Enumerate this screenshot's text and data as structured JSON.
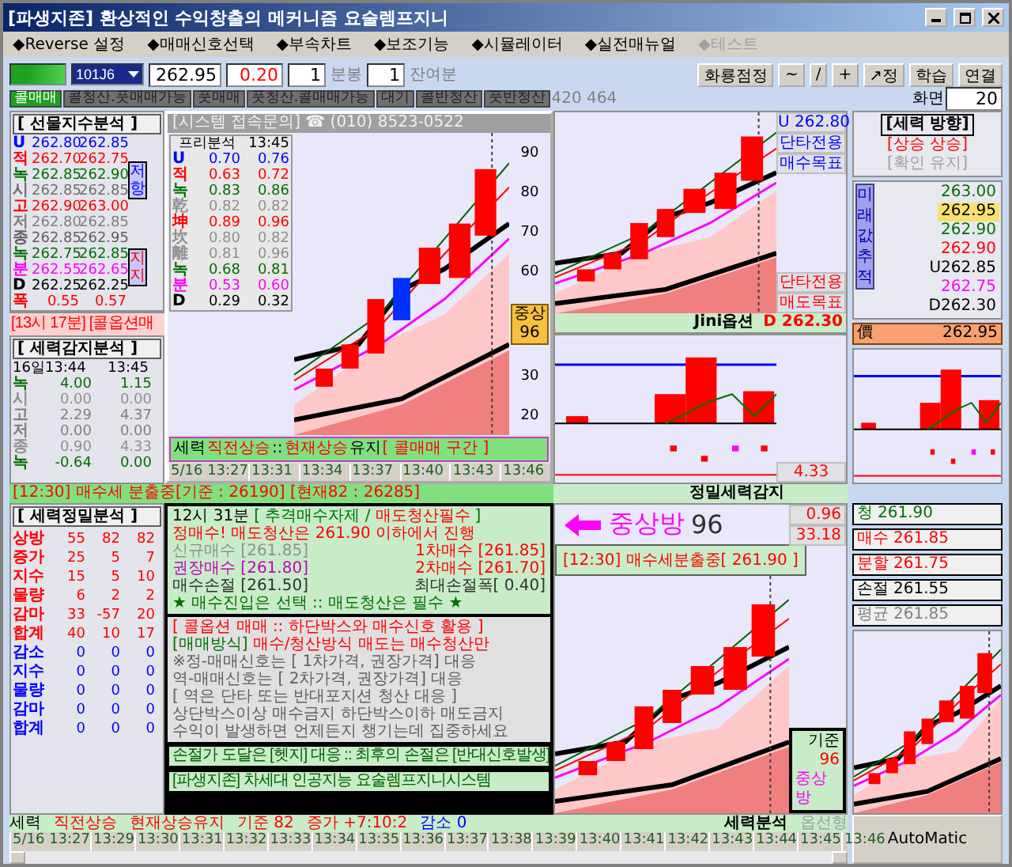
{
  "window": {
    "title": "[파생지존] 환상적인 수익창출의 메커니즘 요술렘프지니"
  },
  "menu": [
    {
      "label": "◆Reverse 설정",
      "disabled": false
    },
    {
      "label": "◆매매신호선택",
      "disabled": false
    },
    {
      "label": "◆부속차트",
      "disabled": false
    },
    {
      "label": "◆보조기능",
      "disabled": false
    },
    {
      "label": "◆시뮬레이터",
      "disabled": false
    },
    {
      "label": "◆실전매뉴얼",
      "disabled": false
    },
    {
      "label": "◆테스트",
      "disabled": true
    }
  ],
  "toolbar": {
    "code": "101J6",
    "price": "262.95",
    "change": "0.20",
    "interval": "1",
    "interval_label": "분봉",
    "remaining": "1",
    "remaining_label": "잔여분",
    "buttons": [
      "화룡점정",
      "~",
      "/",
      "+",
      "↗정",
      "학습",
      "연결"
    ]
  },
  "signals": [
    {
      "label": "콜매매",
      "selected": true
    },
    {
      "label": "콜청산.풋매매가능",
      "selected": false
    },
    {
      "label": "풋매매",
      "selected": false
    },
    {
      "label": "풋청산.콜매매가능",
      "selected": false
    },
    {
      "label": "대기",
      "selected": false
    },
    {
      "label": "콜반청산",
      "selected": false
    },
    {
      "label": "풋반청산",
      "selected": false
    }
  ],
  "signal_count": "420 464",
  "screen": {
    "label": "화면",
    "value": "20"
  },
  "futures_panel": {
    "title": "[ 선물지수분석 ]",
    "rows": [
      {
        "label": "U",
        "values": [
          "262.80",
          "262.85"
        ],
        "color": "#0000ff"
      },
      {
        "label": "적",
        "values": [
          "262.70",
          "262.75"
        ],
        "color": "#ff0000"
      },
      {
        "label": "녹",
        "values": [
          "262.85",
          "262.90"
        ],
        "color": "#007000"
      },
      {
        "label": "시",
        "values": [
          "262.85",
          "262.85"
        ],
        "color": "#707070"
      },
      {
        "label": "고",
        "values": [
          "262.90",
          "263.00"
        ],
        "color": "#ff0000"
      },
      {
        "label": "저",
        "values": [
          "262.80",
          "262.85"
        ],
        "color": "#808080"
      },
      {
        "label": "종",
        "values": [
          "262.85",
          "262.95"
        ],
        "color": "#606060"
      },
      {
        "label": "녹",
        "values": [
          "262.75",
          "262.85"
        ],
        "color": "#007000"
      },
      {
        "label": "분",
        "values": [
          "262.55",
          "262.65"
        ],
        "color": "#ff00ff"
      },
      {
        "label": "D",
        "values": [
          "262.25",
          "262.25"
        ],
        "color": "#000000"
      },
      {
        "label": "폭",
        "values": [
          "0.55",
          "0.57"
        ],
        "color": "#ff0000"
      }
    ],
    "side_labels": [
      {
        "text": "저항",
        "color": "#0000ff"
      },
      {
        "text": "지지",
        "color": "#ff0000"
      }
    ]
  },
  "alert_band": "[13시 17분] [콜옵션매",
  "power_panel": {
    "title": "[ 세력감지분석 ]",
    "date": "16일13:44",
    "time": "13:45",
    "rows": [
      {
        "label": "녹",
        "values": [
          "4.00",
          "1.15"
        ],
        "color": "#007000"
      },
      {
        "label": "시",
        "values": [
          "0.00",
          "0.00"
        ],
        "color": "#909090"
      },
      {
        "label": "고",
        "values": [
          "2.29",
          "4.37"
        ],
        "color": "#808080"
      },
      {
        "label": "저",
        "values": [
          "0.00",
          "0.00"
        ],
        "color": "#808080"
      },
      {
        "label": "종",
        "values": [
          "0.90",
          "4.33"
        ],
        "color": "#909090"
      },
      {
        "label": "녹",
        "values": [
          "-0.64",
          "0.00"
        ],
        "color": "#007000"
      }
    ]
  },
  "popup": {
    "title": "[시스템 접속문의] ☎ (010) 8523-0522",
    "table_title": "프리분석",
    "table_time": "13:45",
    "rows": [
      {
        "label": "U",
        "values": [
          "0.70",
          "0.76"
        ],
        "color": "#0000ff"
      },
      {
        "label": "적",
        "values": [
          "0.63",
          "0.72"
        ],
        "color": "#ff0000"
      },
      {
        "label": "녹",
        "values": [
          "0.83",
          "0.86"
        ],
        "color": "#007000"
      },
      {
        "label": "乾",
        "values": [
          "0.82",
          "0.82"
        ],
        "color": "#909090"
      },
      {
        "label": "坤",
        "values": [
          "0.89",
          "0.96"
        ],
        "color": "#ff0000"
      },
      {
        "label": "坎",
        "values": [
          "0.80",
          "0.82"
        ],
        "color": "#909090"
      },
      {
        "label": "離",
        "values": [
          "0.81",
          "0.96"
        ],
        "color": "#909090"
      },
      {
        "label": "녹",
        "values": [
          "0.68",
          "0.81"
        ],
        "color": "#007000"
      },
      {
        "label": "분",
        "values": [
          "0.53",
          "0.60"
        ],
        "color": "#ff00ff"
      },
      {
        "label": "D",
        "values": [
          "0.29",
          "0.32"
        ],
        "color": "#000000"
      }
    ],
    "y_labels": [
      "90",
      "80",
      "70",
      "60",
      "30",
      "20"
    ],
    "badge": {
      "label": "중상",
      "value": "96"
    },
    "banner": [
      {
        "text": "세력",
        "kind": "plain"
      },
      {
        "text": "직전상승",
        "kind": "emphasis"
      },
      {
        "text": "::",
        "kind": "plain"
      },
      {
        "text": "현재상승",
        "kind": "emphasis"
      },
      {
        "text": "유지",
        "kind": "plain"
      },
      {
        "text": "[ 콜매매 구간 ]",
        "kind": "emphasis"
      }
    ],
    "times": [
      "5/16 13:27",
      "13:31",
      "13:34",
      "13:37",
      "13:40",
      "13:43",
      "13:46"
    ]
  },
  "upper_chart": {
    "buy_price": "U 262.80",
    "buy_lines": [
      "단타전용",
      "매수목표"
    ],
    "sell_lines": [
      "단타전용",
      "매도목표"
    ],
    "name": "Jini옵션",
    "sell_price": "D 262.30"
  },
  "lower_chart": {
    "value": "4.33",
    "name": "정밀세력감지"
  },
  "direction": {
    "title": "[세력 방향]",
    "lines": [
      {
        "text": "[상승 상승]",
        "color": "#ff0000"
      },
      {
        "text": "[확인 유지]",
        "color": "#a0a0a0"
      }
    ],
    "vertical_label": "미래값추적",
    "prices": [
      {
        "text": "263.00",
        "color": "#007000",
        "selected": false
      },
      {
        "text": "262.95",
        "color": "#000000",
        "selected": true
      },
      {
        "text": "262.90",
        "color": "#007000",
        "selected": false
      },
      {
        "text": "262.90",
        "color": "#ff0000",
        "selected": false
      },
      {
        "text": "U262.85",
        "color": "#000000",
        "selected": false
      },
      {
        "text": "262.75",
        "color": "#ff00ff",
        "selected": false
      },
      {
        "text": "D262.30",
        "color": "#000000",
        "selected": false
      }
    ],
    "current_label": "價",
    "current": "262.95"
  },
  "strip": "[12:30] 매수세 분출중[기준 : 26190] [현재82 : 26285]",
  "precise_panel": {
    "title": "[ 세력정밀분석 ]",
    "rows": [
      {
        "label": "상방",
        "values": [
          "55",
          "82",
          "82"
        ],
        "color": "#ff0000"
      },
      {
        "label": "증가",
        "values": [
          "25",
          "5",
          "7"
        ],
        "color": "#ff0000"
      },
      {
        "label": "지수",
        "values": [
          "15",
          "5",
          "10"
        ],
        "color": "#ff0000"
      },
      {
        "label": "물량",
        "values": [
          "6",
          "2",
          "2"
        ],
        "color": "#ff0000"
      },
      {
        "label": "감마",
        "values": [
          "33",
          "-57",
          "20"
        ],
        "color": "#ff0000"
      },
      {
        "label": "합계",
        "values": [
          "40",
          "10",
          "17"
        ],
        "color": "#ff0000"
      },
      {
        "label": "감소",
        "values": [
          "0",
          "0",
          "0"
        ],
        "color": "#0000ff"
      },
      {
        "label": "지수",
        "values": [
          "0",
          "0",
          "0"
        ],
        "color": "#0000ff"
      },
      {
        "label": "물량",
        "values": [
          "0",
          "0",
          "0"
        ],
        "color": "#0000ff"
      },
      {
        "label": "감마",
        "values": [
          "0",
          "0",
          "0"
        ],
        "color": "#0000ff"
      },
      {
        "label": "합계",
        "values": [
          "0",
          "0",
          "0"
        ],
        "color": "#0000ff"
      }
    ]
  },
  "guide_box": {
    "lines": [
      {
        "kind": "text",
        "parts": [
          {
            "text": "12시 31분",
            "color": "#000000"
          },
          {
            "text": "[ 추격매수자제 /",
            "color": "#007000"
          },
          {
            "text": "매도청산필수",
            "color": "#ff0000"
          },
          {
            "text": "]",
            "color": "#007000"
          }
        ]
      },
      {
        "kind": "text",
        "parts": [
          {
            "text": "정매수! 매도청산은 261.90 이하에서 진행",
            "color": "#ff0000"
          }
        ]
      },
      {
        "kind": "pair",
        "parts": [
          {
            "text": "신규매수 [261.85]",
            "color": "#909090"
          },
          {
            "text": "1차매수 [261.85]",
            "color": "#ff0000"
          }
        ]
      },
      {
        "kind": "pair",
        "parts": [
          {
            "text": "권장매수 [261.80]",
            "color": "#c000c0"
          },
          {
            "text": "2차매수 [261.70]",
            "color": "#ff0000"
          }
        ]
      },
      {
        "kind": "pair",
        "parts": [
          {
            "text": "매수손절 [261.50]",
            "color": "#303030"
          },
          {
            "text": "최대손절폭[ 0.40]",
            "color": "#303030"
          }
        ]
      },
      {
        "kind": "text",
        "parts": [
          {
            "text": "★ 매수진입은 선택 :: 매도청산은 필수 ★",
            "color": "#007000"
          }
        ]
      }
    ]
  },
  "rule_box": {
    "lines": [
      {
        "parts": [
          {
            "text": "[ 콜옵션 매매 :: 하단박스와 매수신호 활용 ]",
            "color": "#ff0000"
          }
        ]
      },
      {
        "parts": [
          {
            "text": "[매매방식]",
            "color": "#007000"
          },
          {
            "text": "매수/청산방식 매도는 매수청산만",
            "color": "#ff0000"
          }
        ]
      },
      {
        "parts": [
          {
            "text": "※정-매매신호는 [ 1차가격, 권장가격] 대응",
            "color": "#606060"
          }
        ]
      },
      {
        "parts": [
          {
            "text": "역-매매신호는 [ 2차가격, 권장가격] 대응",
            "color": "#606060"
          }
        ]
      },
      {
        "parts": [
          {
            "text": "[ 역은 단타 또는 반대포지션 청산 대응 ]",
            "color": "#606060"
          }
        ]
      },
      {
        "parts": [
          {
            "text": "상단박스이상 매수금지 하단박스이하 매도금지",
            "color": "#606060"
          }
        ]
      },
      {
        "parts": [
          {
            "text": "수익이 발생하면 언제든지 챙기는데 집중하세요",
            "color": "#606060"
          }
        ]
      }
    ]
  },
  "notices": [
    "손절가 도달은 [헷지] 대응 :: 최후의 손절은 [반대신호발생]",
    "[파생지존] 차세대 인공지능 요술렘프지니시스템"
  ],
  "bottom_chart": {
    "state": "중상방",
    "score": "96",
    "signal": "[12:30] 매수세분출중[ 261.90 ]",
    "readings": [
      "0.96",
      "33.18"
    ],
    "legend": [
      {
        "text": "기준",
        "color": "#000000"
      },
      {
        "text": "96",
        "color": "#ff0000"
      },
      {
        "text": "중상방",
        "color": "#ff00ff"
      }
    ],
    "name": "세력분석",
    "option": "옵선형"
  },
  "orders": [
    {
      "label": "청",
      "value": "261.90",
      "color": "#007000"
    },
    {
      "label": "매수",
      "value": "261.85",
      "color": "#ff0000"
    },
    {
      "label": "분할",
      "value": "261.75",
      "color": "#ff0000"
    },
    {
      "label": "손절",
      "value": "261.55",
      "color": "#000000"
    },
    {
      "label": "평균",
      "value": "261.85",
      "color": "#808080"
    }
  ],
  "status": [
    {
      "text": "세력",
      "color": "#000000"
    },
    {
      "text": "직전상승",
      "color": "#ff0000"
    },
    {
      "text": "현재상승유지",
      "color": "#ff0000"
    },
    {
      "text": "기준 82",
      "color": "#ff0000"
    },
    {
      "text": "증가 +7:10:2",
      "color": "#ff0000"
    },
    {
      "text": "감소 0",
      "color": "#0000ff"
    }
  ],
  "times": [
    "5/16 13:27",
    "13:29",
    "13:30",
    "13:31",
    "13:32",
    "13:33",
    "13:34",
    "13:35",
    "13:36",
    "13:37",
    "13:38",
    "13:39",
    "13:40",
    "13:41",
    "13:42",
    "13:43",
    "13:44",
    "13:45",
    "13:46"
  ],
  "auto_button": "AutoMatic"
}
